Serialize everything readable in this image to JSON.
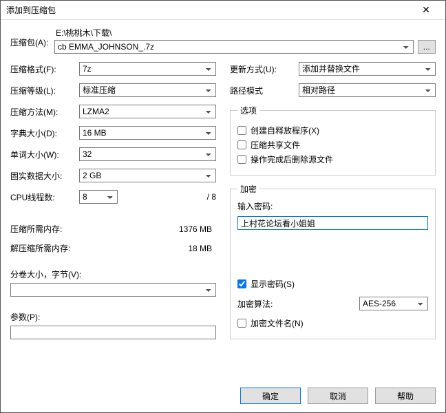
{
  "title": "添加到压缩包",
  "archive": {
    "label": "压缩包(A):",
    "path": "E:\\桃桃木\\下载\\",
    "filename": "cb EMMA_JOHNSON_.7z",
    "browse": "..."
  },
  "left": {
    "format": {
      "label": "压缩格式(F):",
      "value": "7z"
    },
    "level": {
      "label": "压缩等级(L):",
      "value": "标准压缩"
    },
    "method": {
      "label": "压缩方法(M):",
      "value": "LZMA2"
    },
    "dict": {
      "label": "字典大小(D):",
      "value": "16 MB"
    },
    "word": {
      "label": "单词大小(W):",
      "value": "32"
    },
    "solid": {
      "label": "固实数据大小:",
      "value": "2 GB"
    },
    "cpu": {
      "label": "CPU线程数:",
      "value": "8",
      "max": "/       8"
    },
    "mem_comp": {
      "label": "压缩所需内存:",
      "value": "1376 MB"
    },
    "mem_decomp": {
      "label": "解压缩所需内存:",
      "value": "18 MB"
    },
    "split": {
      "label": "分卷大小，字节(V):"
    },
    "params": {
      "label": "参数(P):"
    }
  },
  "right": {
    "update": {
      "label": "更新方式(U):",
      "value": "添加并替换文件"
    },
    "pathmode": {
      "label": "路径模式",
      "value": "相对路径"
    },
    "options": {
      "legend": "选项",
      "sfx": "创建自释放程序(X)",
      "shared": "压缩共享文件",
      "delete": "操作完成后删除源文件"
    },
    "encrypt": {
      "legend": "加密",
      "pwd_label": "输入密码:",
      "pwd_value": "上村花论坛看小姐姐",
      "show_pwd": "显示密码(S)",
      "algo_label": "加密算法:",
      "algo_value": "AES-256",
      "enc_names": "加密文件名(N)"
    }
  },
  "buttons": {
    "ok": "确定",
    "cancel": "取消",
    "help": "帮助"
  }
}
